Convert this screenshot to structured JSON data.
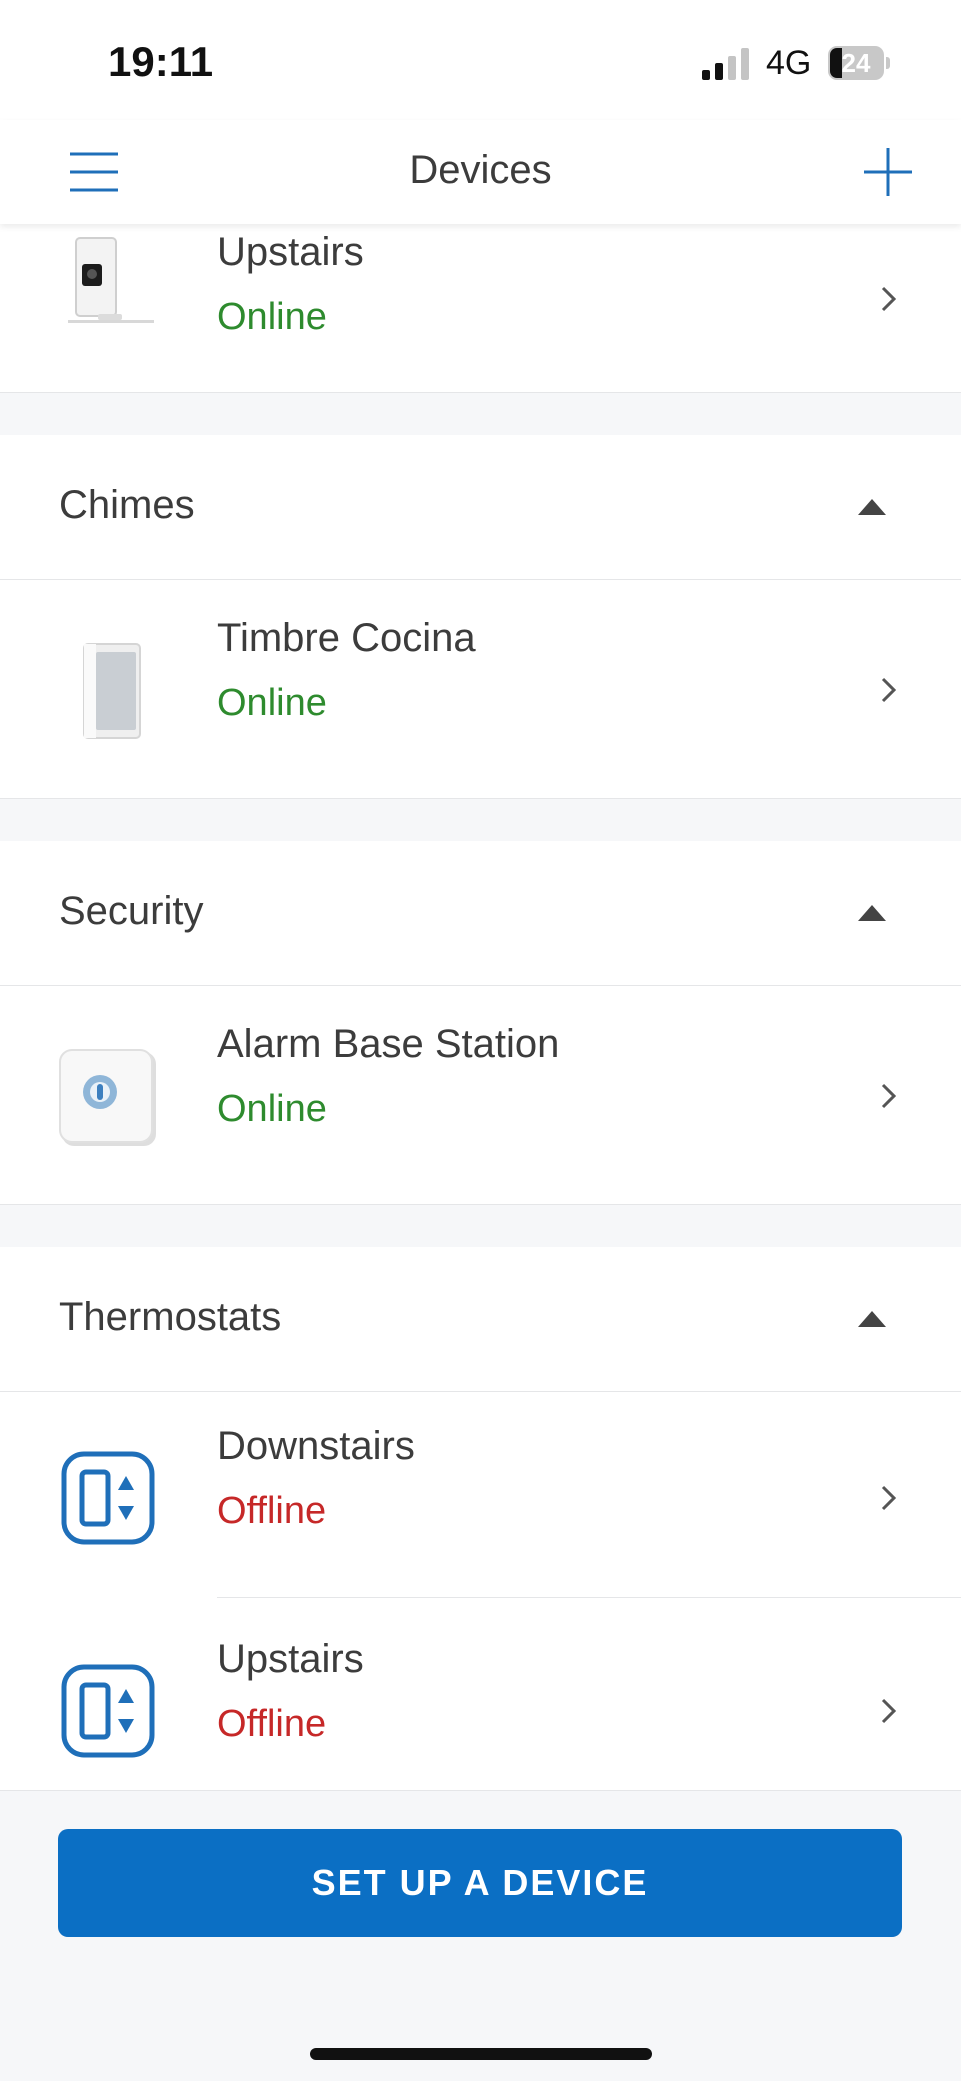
{
  "status_bar": {
    "time": "19:11",
    "network": "4G",
    "battery": "24"
  },
  "nav": {
    "title": "Devices"
  },
  "sections": [
    {
      "title": "Chimes",
      "devices": [
        {
          "name": "Timbre Cocina",
          "status": "Online"
        }
      ]
    },
    {
      "title": "Security",
      "devices": [
        {
          "name": "Alarm Base Station",
          "status": "Online"
        }
      ]
    },
    {
      "title": "Thermostats",
      "devices": [
        {
          "name": "Downstairs",
          "status": "Offline"
        },
        {
          "name": "Upstairs",
          "status": "Offline"
        }
      ]
    }
  ],
  "top_device": {
    "name": "Upstairs",
    "status": "Online"
  },
  "footer": {
    "setup_label": "SET UP A DEVICE"
  },
  "colors": {
    "accent": "#0b6fc4",
    "online": "#2e8b2e",
    "offline": "#c62828"
  }
}
